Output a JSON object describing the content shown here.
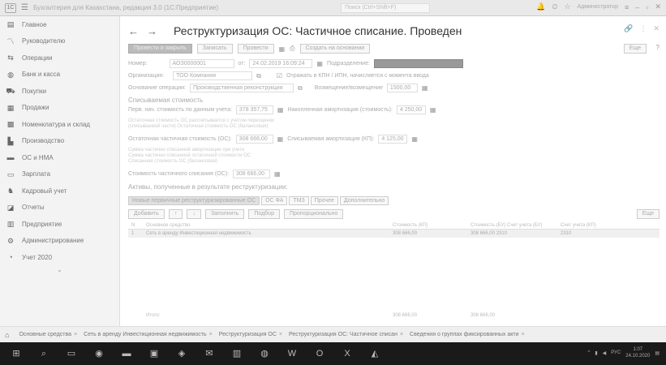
{
  "window": {
    "title": "Бухгалтерия для Казахстана, редакция 3.0  (1С:Предприятие)",
    "search_placeholder": "Поиск (Ctrl+Shift+F)",
    "user": "Администратор"
  },
  "sidebar": {
    "items": [
      {
        "label": "Главное",
        "icon": "home-icon",
        "glyph": "▤"
      },
      {
        "label": "Руководителю",
        "icon": "chart-icon",
        "glyph": "〽"
      },
      {
        "label": "Операции",
        "icon": "operations-icon",
        "glyph": "⇆"
      },
      {
        "label": "Банк и касса",
        "icon": "bank-icon",
        "glyph": "◍"
      },
      {
        "label": "Покупки",
        "icon": "cart-icon",
        "glyph": "⛟"
      },
      {
        "label": "Продажи",
        "icon": "sales-icon",
        "glyph": "▦"
      },
      {
        "label": "Номенклатура и склад",
        "icon": "warehouse-icon",
        "glyph": "▩"
      },
      {
        "label": "Производство",
        "icon": "factory-icon",
        "glyph": "▙"
      },
      {
        "label": "ОС и НМА",
        "icon": "assets-icon",
        "glyph": "▬"
      },
      {
        "label": "Зарплата",
        "icon": "salary-icon",
        "glyph": "▭"
      },
      {
        "label": "Кадровый учет",
        "icon": "staff-icon",
        "glyph": "♞"
      },
      {
        "label": "Отчеты",
        "icon": "reports-icon",
        "glyph": "◪"
      },
      {
        "label": "Предприятие",
        "icon": "enterprise-icon",
        "glyph": "▥"
      },
      {
        "label": "Администрирование",
        "icon": "settings-icon",
        "glyph": "⚙"
      },
      {
        "label": "Учет 2020",
        "icon": "accounting-icon",
        "glyph": "◔"
      }
    ],
    "more": "⌄"
  },
  "document": {
    "title": "Реструктуризация ОС: Частичное списание. Проведен",
    "toolbar": {
      "post_close": "Провести и закрыть",
      "save": "Записать",
      "post": "Провести",
      "create_based": "Создать на основании",
      "more": "Еще",
      "help": "?"
    },
    "fields": {
      "number_label": "Номер:",
      "number_value": "АОЗ0000001",
      "date_label": "от:",
      "date_value": "24.02.2019 16:09:24",
      "subdivision_label": "Подразделение:",
      "org_label": "Организация:",
      "org_value": "ТОО Компания",
      "reflect_label": "Отражать в КПН / ИПН, начисляется с момента ввода",
      "method_label": "Основание операции:",
      "method_value": "Производственная реконструкция",
      "cost_label": "Возмещение/возмещение",
      "cost_value": "1500,00"
    },
    "section_title": "Списываемая стоимость",
    "initial_cost_label": "Перв. нач. стоимость по данным учета:",
    "initial_cost_value": "378 357,75",
    "depreciation_label": "Накопленная амортизация (стоимость):",
    "depreciation_value": "4 250,00",
    "note1": "Остаточная стоимость ОС рассчитывается с учетом переоценок",
    "note2": "(списываемой части) Остаточная стоимость ОС (балансовая)",
    "residual_label": "Остаточная частичная стоимость (ОС):",
    "residual_value": "308 666,00",
    "residual_amort_label": "Списываемая амортизация (КП):",
    "residual_amort_value": "4 125,00",
    "note3": "Сумма частично списанной амортизации при учете",
    "note4": "Сумма частично списанной остаточной стоимости ОС",
    "note5": "Списанная стоимость ОС (балансовая)",
    "partial_cost_label": "Стоимость частичного списания (ОС):",
    "partial_cost_value": "308 666,00",
    "section2_title": "Активы, полученные в результате реструктуризации:"
  },
  "tabs": [
    {
      "label": "Новые первичные реструктуризированные ОС",
      "active": true
    },
    {
      "label": "ОС ФА",
      "active": false
    },
    {
      "label": "ТМЗ",
      "active": false
    },
    {
      "label": "Прочее",
      "active": false
    },
    {
      "label": "Дополнительно",
      "active": false
    }
  ],
  "table_toolbar": {
    "add": "Добавить",
    "up": "↑",
    "down": "↓",
    "fill": "Заполнить",
    "select": "Подбор",
    "distribute": "Пропорционально",
    "more": "Еще"
  },
  "table": {
    "headers": [
      "N",
      "Основное средство",
      "",
      "Стоимость (КП)",
      "Стоимость (БУ)  Счет учета (БУ)",
      "Счет учета (КП)"
    ],
    "rows": [
      [
        "1",
        "Сеть в аренду Инвестиционная недвижимость",
        "",
        "308 666,00",
        "308 666,00  2310",
        "2310"
      ]
    ],
    "totals": [
      "",
      "Итого:",
      "",
      "308 666,00",
      "308 666,00",
      ""
    ]
  },
  "open_tabs": [
    "Основные средства",
    "Сеть в аренду Инвестиционная недвижимость",
    "Реструктуризация ОС",
    "Реструктуризация ОС: Частичное списан",
    "Сведения о группах фиксированных акти"
  ],
  "taskbar": {
    "time": "1:07",
    "date": "24.10.2020",
    "lang": "РУС"
  }
}
